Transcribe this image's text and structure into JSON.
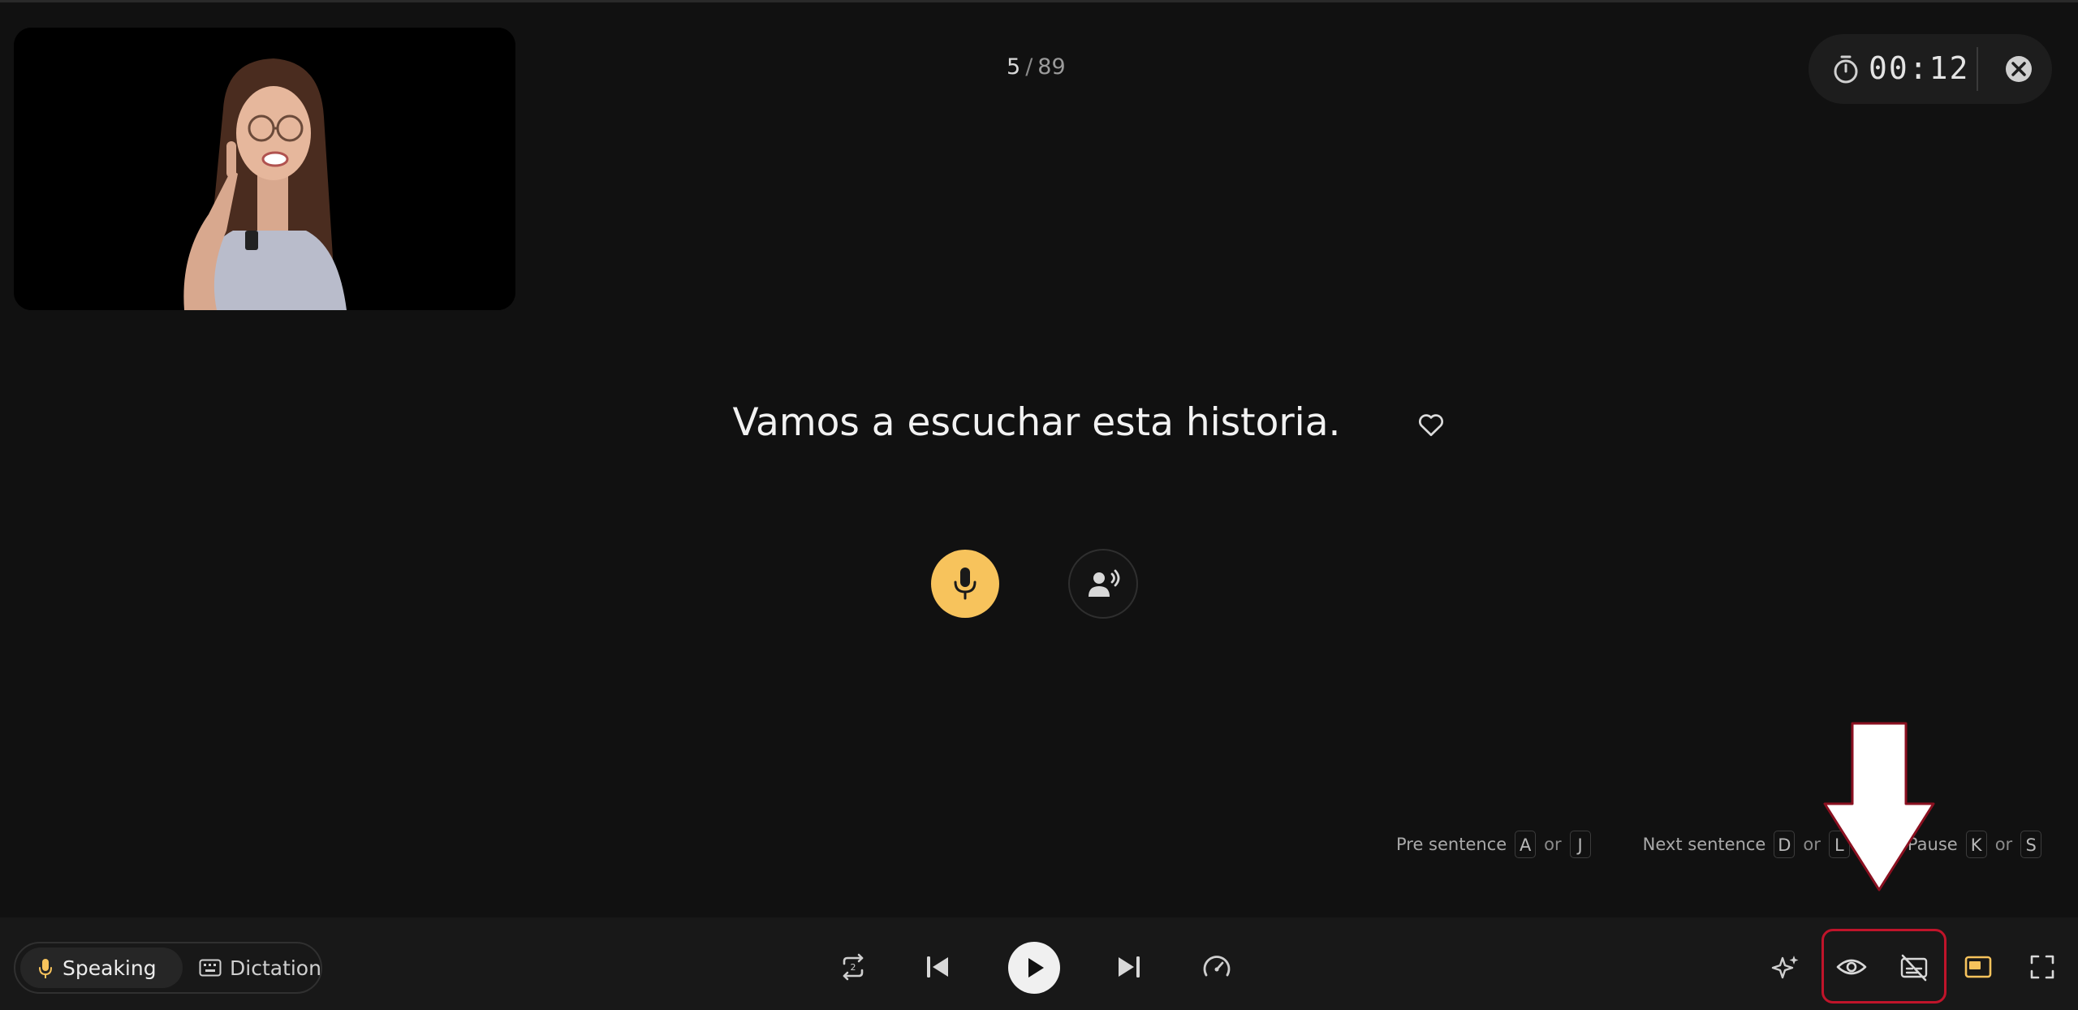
{
  "counter": {
    "current": "5",
    "separator": "/",
    "total": "89"
  },
  "timer": {
    "time": "00:12"
  },
  "sentence": {
    "text": "Vamos a escuchar esta historia."
  },
  "shortcuts": [
    {
      "label": "Pre sentence",
      "key1": "A",
      "or": "or",
      "key2": "J"
    },
    {
      "label": "Next sentence",
      "key1": "D",
      "or": "or",
      "key2": "L"
    },
    {
      "label": "/Pause",
      "key1": "K",
      "or": "or",
      "key2": "S"
    }
  ],
  "modes": {
    "speaking": "Speaking",
    "dictation": "Dictation"
  },
  "colors": {
    "accent": "#f7c35c",
    "highlight": "#c0142a",
    "background": "#111111",
    "bar": "#181818"
  },
  "icons": {
    "timer": "stopwatch-icon",
    "close": "close-circle-icon",
    "favorite": "heart-icon",
    "record": "microphone-icon",
    "listen": "speaker-voice-icon",
    "loop": "repeat-icon",
    "prev": "skip-back-icon",
    "play": "play-icon",
    "next": "skip-forward-icon",
    "speed": "speedometer-icon",
    "ai": "sparkle-icon",
    "show": "eye-icon",
    "hide": "subtitles-off-icon",
    "layout": "layout-icon",
    "fullscreen": "fullscreen-icon"
  }
}
